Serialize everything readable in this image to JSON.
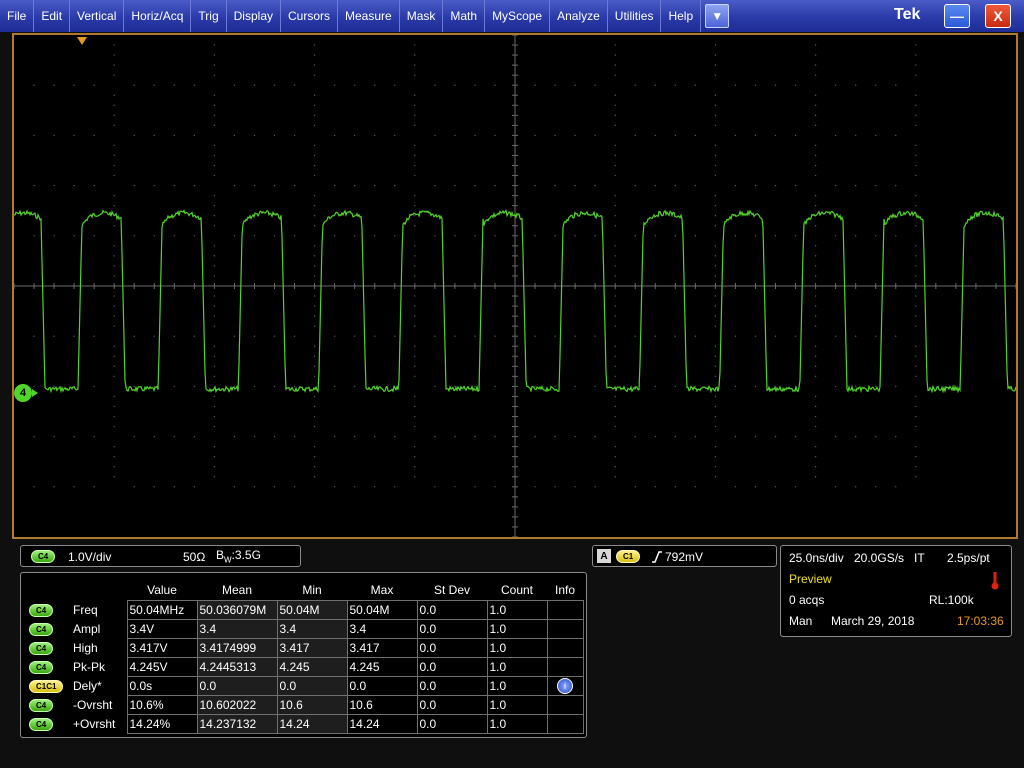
{
  "menu": {
    "items": [
      "File",
      "Edit",
      "Vertical",
      "Horiz/Acq",
      "Trig",
      "Display",
      "Cursors",
      "Measure",
      "Mask",
      "Math",
      "MyScope",
      "Analyze",
      "Utilities",
      "Help"
    ],
    "dropdown_glyph": "▼",
    "brand": "Tek",
    "minimize_glyph": "—",
    "close_glyph": "X"
  },
  "waveform": {
    "channel": "4",
    "color": "#52d52a",
    "trace_start": "high",
    "samples": [
      0.2,
      3.2,
      3.3,
      3.3,
      3.1,
      0.2,
      0.2,
      0.2,
      0.2,
      3.2,
      3.3,
      3.3,
      3.2,
      0.2,
      0.2,
      0.2,
      0.2
    ]
  },
  "vertical": {
    "channel_badge": "C4",
    "scale": "1.0V/div",
    "impedance": "50Ω",
    "bw_label": "B",
    "bw_sub": "W",
    "bw_value": ":3.5G"
  },
  "trigger": {
    "source_label": "A",
    "channel_badge": "C1",
    "level": "792mV"
  },
  "horizontal": {
    "scale": "25.0ns/div",
    "sample_rate": "20.0GS/s",
    "mode": "IT",
    "resolution": "2.5ps/pt",
    "status": "Preview",
    "acqs": "0 acqs",
    "record_length": "RL:100k",
    "trigger_mode": "Man",
    "date": "March 29, 2018",
    "time": "17:03:36",
    "status_color": "#f0e020",
    "time_color": "#e89a20"
  },
  "measurements": {
    "headers": [
      "Value",
      "Mean",
      "Min",
      "Max",
      "St Dev",
      "Count",
      "Info"
    ],
    "rows": [
      {
        "badge": "C4",
        "badge_style": "green",
        "name": "Freq",
        "value": "50.04MHz",
        "mean": "50.036079M",
        "min": "50.04M",
        "max": "50.04M",
        "stdev": "0.0",
        "count": "1.0",
        "info": ""
      },
      {
        "badge": "C4",
        "badge_style": "green",
        "name": "Ampl",
        "value": "3.4V",
        "mean": "3.4",
        "min": "3.4",
        "max": "3.4",
        "stdev": "0.0",
        "count": "1.0",
        "info": ""
      },
      {
        "badge": "C4",
        "badge_style": "green",
        "name": "High",
        "value": "3.417V",
        "mean": "3.4174999",
        "min": "3.417",
        "max": "3.417",
        "stdev": "0.0",
        "count": "1.0",
        "info": ""
      },
      {
        "badge": "C4",
        "badge_style": "green",
        "name": "Pk-Pk",
        "value": "4.245V",
        "mean": "4.2445313",
        "min": "4.245",
        "max": "4.245",
        "stdev": "0.0",
        "count": "1.0",
        "info": ""
      },
      {
        "badge": "C1C1",
        "badge_style": "yellow",
        "name": "Dely*",
        "value": "0.0s",
        "mean": "0.0",
        "min": "0.0",
        "max": "0.0",
        "stdev": "0.0",
        "count": "1.0",
        "info": "i"
      },
      {
        "badge": "C4",
        "badge_style": "green",
        "name": "-Ovrsht",
        "value": "10.6%",
        "mean": "10.602022",
        "min": "10.6",
        "max": "10.6",
        "stdev": "0.0",
        "count": "1.0",
        "info": ""
      },
      {
        "badge": "C4",
        "badge_style": "green",
        "name": "+Ovrsht",
        "value": "14.24%",
        "mean": "14.237132",
        "min": "14.24",
        "max": "14.24",
        "stdev": "0.0",
        "count": "1.0",
        "info": ""
      }
    ]
  }
}
